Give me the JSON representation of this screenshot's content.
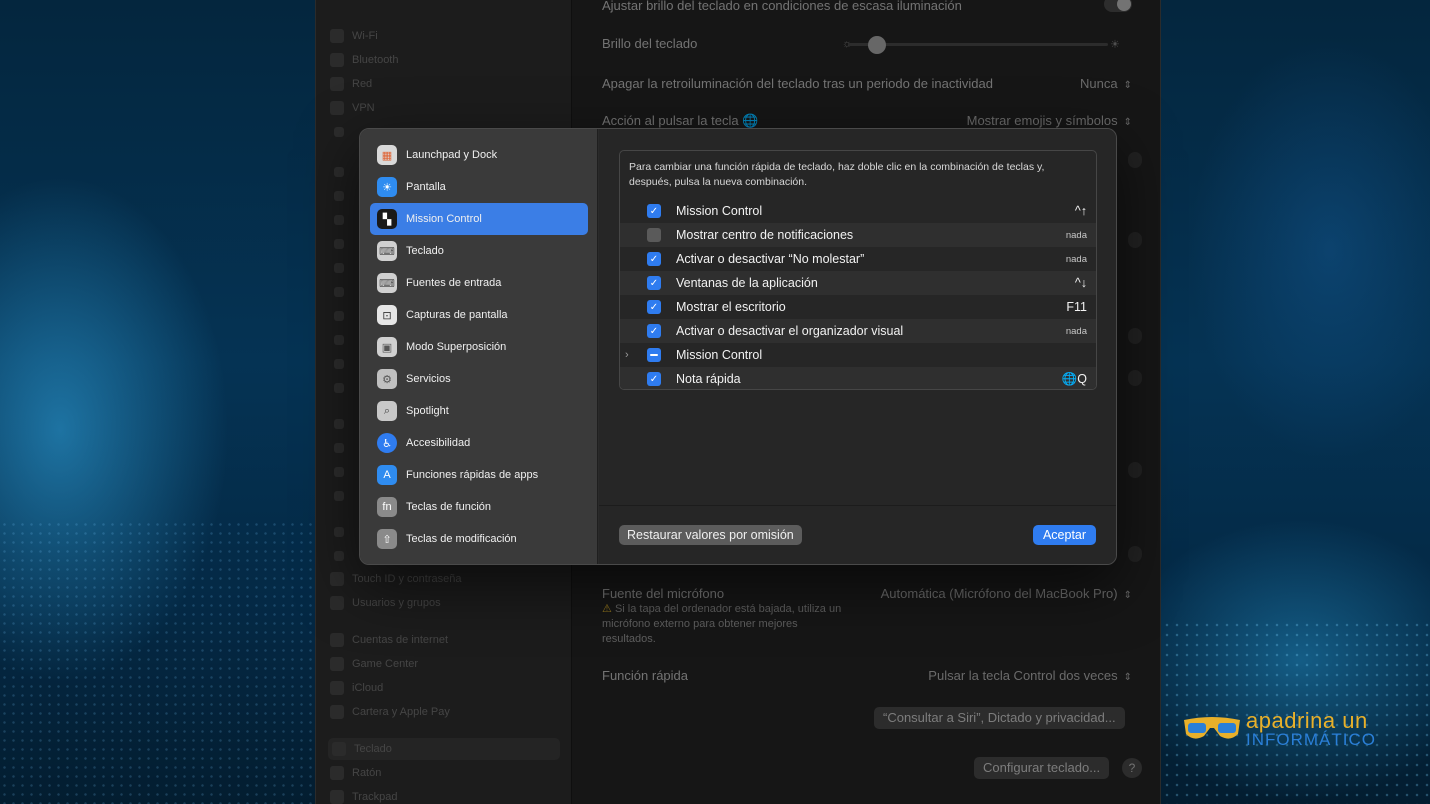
{
  "settings_sidebar": {
    "items": [
      {
        "label": "Wi-Fi"
      },
      {
        "label": "Bluetooth"
      },
      {
        "label": "Red"
      },
      {
        "label": "VPN"
      },
      {
        "label": "Touch ID y contraseña"
      },
      {
        "label": "Usuarios y grupos"
      },
      {
        "label": "Cuentas de internet"
      },
      {
        "label": "Game Center"
      },
      {
        "label": "iCloud"
      },
      {
        "label": "Cartera y Apple Pay"
      },
      {
        "label": "Teclado"
      },
      {
        "label": "Ratón"
      },
      {
        "label": "Trackpad"
      }
    ]
  },
  "settings_main": {
    "ajustar_brillo_label": "Ajustar brillo del teclado en condiciones de escasa iluminación",
    "brillo_label": "Brillo del teclado",
    "apagar_label": "Apagar la retroiluminación del teclado tras un periodo de inactividad",
    "apagar_value": "Nunca",
    "accion_label": "Acción al pulsar la tecla 🌐",
    "accion_value": "Mostrar emojis y símbolos",
    "fuente_microfono_label": "Fuente del micrófono",
    "fuente_microfono_value": "Automática (Micrófono del MacBook Pro)",
    "mic_note": "Si la tapa del ordenador está bajada, utiliza un micrófono externo para obtener mejores resultados.",
    "funcion_rapida_label": "Función rápida",
    "funcion_rapida_value": "Pulsar la tecla Control dos veces",
    "siri_button": "“Consultar a Siri”, Dictado y privacidad...",
    "configurar_button": "Configurar teclado...",
    "help_button": "?"
  },
  "sheet": {
    "categories": [
      {
        "label": "Launchpad y Dock",
        "icon": "launchpad-icon",
        "color": "#d9d9d9",
        "selected": false
      },
      {
        "label": "Pantalla",
        "icon": "display-sun-icon",
        "color": "#2f8cf0",
        "selected": false
      },
      {
        "label": "Mission Control",
        "icon": "mission-control-icon",
        "color": "#1a1a1a",
        "selected": true
      },
      {
        "label": "Teclado",
        "icon": "keyboard-icon",
        "color": "#d0d0d0",
        "selected": false
      },
      {
        "label": "Fuentes de entrada",
        "icon": "input-sources-icon",
        "color": "#d0d0d0",
        "selected": false
      },
      {
        "label": "Capturas de pantalla",
        "icon": "screenshot-icon",
        "color": "#e6e6e6",
        "selected": false
      },
      {
        "label": "Modo Superposición",
        "icon": "presenter-overlay-icon",
        "color": "#d0d0d0",
        "selected": false
      },
      {
        "label": "Servicios",
        "icon": "services-gear-icon",
        "color": "#c0c0c0",
        "selected": false
      },
      {
        "label": "Spotlight",
        "icon": "spotlight-icon",
        "color": "#c8c8c8",
        "selected": false
      },
      {
        "label": "Accesibilidad",
        "icon": "accessibility-icon",
        "color": "#2f7cf0",
        "selected": false
      },
      {
        "label": "Funciones rápidas de apps",
        "icon": "app-store-icon",
        "color": "#2f8cf0",
        "selected": false
      },
      {
        "label": "Teclas de función",
        "icon": "fn-key-icon",
        "color": "#8a8a8a",
        "selected": false
      },
      {
        "label": "Teclas de modificación",
        "icon": "modifier-keys-icon",
        "color": "#8a8a8a",
        "selected": false
      }
    ],
    "hint": "Para cambiar una función rápida de teclado, haz doble clic en la combinación de teclas y, después, pulsa la nueva combinación.",
    "shortcuts": [
      {
        "label": "Mission Control",
        "key": "^↑",
        "state": "on",
        "expandable": false
      },
      {
        "label": "Mostrar centro de notificaciones",
        "key": "nada",
        "state": "off",
        "expandable": false
      },
      {
        "label": "Activar o desactivar “No molestar”",
        "key": "nada",
        "state": "on",
        "expandable": false
      },
      {
        "label": "Ventanas de la aplicación",
        "key": "^↓",
        "state": "on",
        "expandable": false
      },
      {
        "label": "Mostrar el escritorio",
        "key": "F11",
        "state": "on",
        "expandable": false
      },
      {
        "label": "Activar o desactivar el organizador visual",
        "key": "nada",
        "state": "on",
        "expandable": false
      },
      {
        "label": "Mission Control",
        "key": "",
        "state": "mixed",
        "expandable": true
      },
      {
        "label": "Nota rápida",
        "key": "🌐Q",
        "state": "on",
        "expandable": false
      }
    ],
    "restore_button": "Restaurar valores por omisión",
    "accept_button": "Aceptar"
  },
  "watermark": {
    "line1": "apadrina un",
    "line2": "INFORMÁTICO"
  },
  "colors": {
    "accent": "#2f7cf0",
    "selected_row": "#3b7ee6",
    "watermark_orange": "#e8b02a",
    "watermark_blue": "#2a7fd8"
  }
}
